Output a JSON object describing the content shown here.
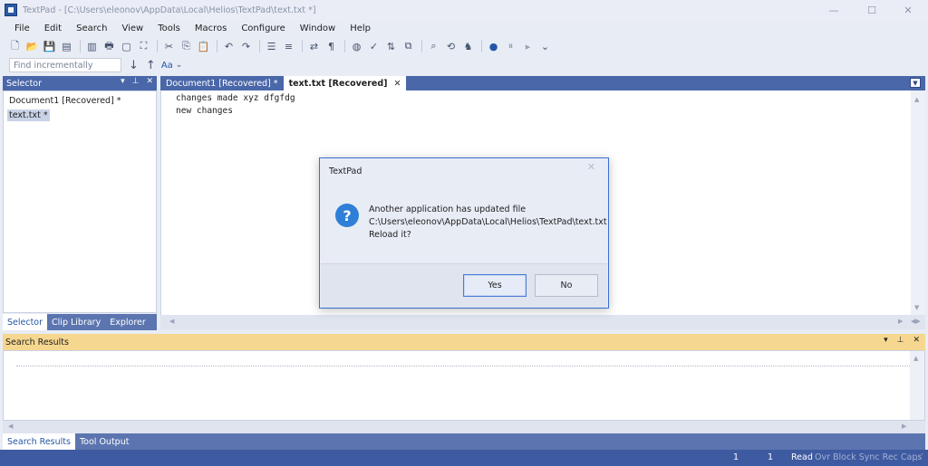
{
  "window": {
    "title": "TextPad - [C:\\Users\\eleonov\\AppData\\Local\\Helios\\TextPad\\text.txt *]",
    "minimize_glyph": "—",
    "maximize_glyph": "☐",
    "close_glyph": "✕"
  },
  "menu": [
    "File",
    "Edit",
    "Search",
    "View",
    "Tools",
    "Macros",
    "Configure",
    "Window",
    "Help"
  ],
  "toolbar": {
    "find_placeholder": "Find incrementally",
    "case_label": "Aa"
  },
  "selector": {
    "title": "Selector",
    "items": [
      "Document1 [Recovered] *",
      "text.txt *"
    ],
    "tabs": [
      "Selector",
      "Clip Library",
      "Explorer"
    ]
  },
  "tabs": {
    "doc1": "Document1 [Recovered] *",
    "doc2": "text.txt [Recovered]",
    "close_glyph": "✕"
  },
  "editor": {
    "lines": [
      "changes made xyz dfgfdg",
      "new changes"
    ]
  },
  "results": {
    "title": "Search Results",
    "tabs": [
      "Search Results",
      "Tool Output"
    ]
  },
  "status": {
    "line": "1",
    "col": "1",
    "read": "Read",
    "flags": "Ovr Block Sync Rec Caps"
  },
  "dialog": {
    "title": "TextPad",
    "message": [
      "Another application has updated file",
      "C:\\Users\\eleonov\\AppData\\Local\\Helios\\TextPad\\text.txt",
      "Reload it?"
    ],
    "yes_label": "Yes",
    "no_label": "No",
    "close_glyph": "✕"
  },
  "colors": {
    "accent": "#4a67a9",
    "status_bar": "#3e5aa0",
    "results_header": "#f6d790",
    "dialog_border": "#3b6fd4"
  }
}
